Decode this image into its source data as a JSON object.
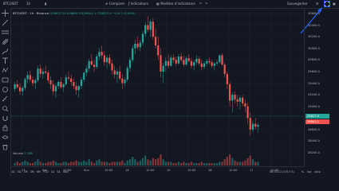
{
  "topbar": {
    "symbol": "BTCUSDT",
    "interval": "1h",
    "compare": "Comparer",
    "indicators": "Indicateurs",
    "templates": "Modèles d'indicateurs",
    "save": "Sauvegarder"
  },
  "legend": {
    "symbol": "BTCUSDT · 1h · Binance",
    "values": "O29837.9 H29860.9 B29841.1 C29837.9 −0.6 (−0.00%)"
  },
  "price_axis": [
    "30600.0",
    "30400.0",
    "30200.0",
    "30000.0",
    "29800.0",
    "29600.0",
    "29400.0",
    "29200.0",
    "29000.0",
    "28800.0",
    "28600.0",
    "28400.0",
    "28200.0"
  ],
  "price_tags": {
    "last": "29827.9",
    "prev": "29841.1"
  },
  "time_axis": [
    "13",
    "Sat",
    "12:00",
    "Sun",
    "12:00",
    "14",
    "12:00",
    "15",
    "12:00",
    "16",
    "12:00",
    "17",
    "12:00"
  ],
  "volume": {
    "label": "Volume",
    "value": "1.768"
  },
  "bottom_tabs": [
    "1D",
    "5D",
    "1M",
    "3M",
    "6M",
    "YTD",
    "1A",
    "5A",
    "Tout"
  ],
  "clock": "08:53:12 (UTC+2)",
  "bottom_right": [
    "%",
    "log",
    "auto"
  ],
  "colors": {
    "up": "#26a69a",
    "down": "#ef5350",
    "accent": "#2962ff"
  },
  "chart_data": {
    "type": "candlestick",
    "ylim": [
      28200,
      30600
    ],
    "ohlc": [
      [
        29300,
        29420,
        29250,
        29380
      ],
      [
        29380,
        29450,
        29300,
        29330
      ],
      [
        29330,
        29400,
        29200,
        29260
      ],
      [
        29260,
        29350,
        29180,
        29320
      ],
      [
        29320,
        29500,
        29280,
        29470
      ],
      [
        29470,
        29600,
        29400,
        29540
      ],
      [
        29540,
        29620,
        29420,
        29460
      ],
      [
        29460,
        29520,
        29350,
        29400
      ],
      [
        29400,
        29480,
        29300,
        29450
      ],
      [
        29450,
        29700,
        29420,
        29650
      ],
      [
        29650,
        29720,
        29500,
        29560
      ],
      [
        29560,
        29650,
        29480,
        29600
      ],
      [
        29600,
        29700,
        29550,
        29580
      ],
      [
        29580,
        29620,
        29400,
        29450
      ],
      [
        29450,
        29520,
        29300,
        29380
      ],
      [
        29380,
        29450,
        29200,
        29260
      ],
      [
        29260,
        29400,
        29150,
        29350
      ],
      [
        29350,
        29450,
        29300,
        29420
      ],
      [
        29420,
        29500,
        29300,
        29330
      ],
      [
        29330,
        29400,
        29250,
        29380
      ],
      [
        29380,
        29550,
        29350,
        29500
      ],
      [
        29500,
        29600,
        29450,
        29480
      ],
      [
        29480,
        29550,
        29350,
        29420
      ],
      [
        29420,
        29480,
        29300,
        29350
      ],
      [
        29350,
        29420,
        29200,
        29280
      ],
      [
        29280,
        29380,
        29150,
        29350
      ],
      [
        29350,
        29500,
        29300,
        29460
      ],
      [
        29460,
        29600,
        29420,
        29580
      ],
      [
        29580,
        29700,
        29520,
        29650
      ],
      [
        29650,
        29820,
        29600,
        29780
      ],
      [
        29780,
        29900,
        29700,
        29720
      ],
      [
        29720,
        29800,
        29600,
        29680
      ],
      [
        29680,
        29900,
        29650,
        29860
      ],
      [
        29860,
        30000,
        29800,
        29940
      ],
      [
        29940,
        30050,
        29820,
        29880
      ],
      [
        29880,
        29950,
        29700,
        29760
      ],
      [
        29760,
        29880,
        29650,
        29840
      ],
      [
        29840,
        29900,
        29700,
        29740
      ],
      [
        29740,
        29800,
        29550,
        29620
      ],
      [
        29620,
        29700,
        29480,
        29550
      ],
      [
        29550,
        29650,
        29400,
        29600
      ],
      [
        29600,
        29700,
        29450,
        29480
      ],
      [
        29480,
        29560,
        29300,
        29400
      ],
      [
        29400,
        29500,
        29350,
        29460
      ],
      [
        29460,
        29700,
        29420,
        29660
      ],
      [
        29660,
        29850,
        29600,
        29800
      ],
      [
        29800,
        30050,
        29760,
        30000
      ],
      [
        30000,
        30150,
        29900,
        30080
      ],
      [
        30080,
        30200,
        29980,
        30020
      ],
      [
        30020,
        30150,
        29950,
        30100
      ],
      [
        30100,
        30300,
        30050,
        30250
      ],
      [
        30250,
        30450,
        30200,
        30400
      ],
      [
        30400,
        30550,
        30280,
        30320
      ],
      [
        30320,
        30500,
        30200,
        30460
      ],
      [
        30460,
        30520,
        30150,
        30200
      ],
      [
        30200,
        30350,
        30000,
        30050
      ],
      [
        30050,
        30200,
        29800,
        29880
      ],
      [
        29880,
        30000,
        29500,
        29600
      ],
      [
        29600,
        29750,
        29400,
        29700
      ],
      [
        29700,
        29850,
        29600,
        29780
      ],
      [
        29780,
        29900,
        29650,
        29700
      ],
      [
        29700,
        29880,
        29680,
        29840
      ],
      [
        29840,
        29900,
        29750,
        29800
      ],
      [
        29800,
        29860,
        29700,
        29740
      ],
      [
        29740,
        29900,
        29720,
        29860
      ],
      [
        29860,
        29920,
        29760,
        29800
      ],
      [
        29800,
        29880,
        29680,
        29720
      ],
      [
        29720,
        29860,
        29700,
        29830
      ],
      [
        29830,
        29900,
        29760,
        29780
      ],
      [
        29780,
        29840,
        29650,
        29700
      ],
      [
        29700,
        29800,
        29620,
        29760
      ],
      [
        29760,
        29880,
        29720,
        29820
      ],
      [
        29820,
        29860,
        29700,
        29740
      ],
      [
        29740,
        29800,
        29620,
        29680
      ],
      [
        29680,
        29780,
        29640,
        29740
      ],
      [
        29740,
        29820,
        29700,
        29780
      ],
      [
        29780,
        29840,
        29720,
        29760
      ],
      [
        29760,
        29800,
        29660,
        29700
      ],
      [
        29700,
        29760,
        29620,
        29740
      ],
      [
        29740,
        29800,
        29700,
        29760
      ],
      [
        29760,
        29900,
        29740,
        29880
      ],
      [
        29880,
        29920,
        29700,
        29720
      ],
      [
        29720,
        29760,
        29500,
        29560
      ],
      [
        29560,
        29600,
        29300,
        29380
      ],
      [
        29380,
        29420,
        29000,
        29100
      ],
      [
        29100,
        29250,
        28900,
        29200
      ],
      [
        29200,
        29260,
        29050,
        29120
      ],
      [
        29120,
        29200,
        29000,
        29080
      ],
      [
        29080,
        29180,
        28950,
        29150
      ],
      [
        29150,
        29200,
        29000,
        29050
      ],
      [
        29050,
        29120,
        28900,
        29000
      ],
      [
        29000,
        29060,
        28700,
        28800
      ],
      [
        28800,
        28900,
        28500,
        28600
      ],
      [
        28600,
        28760,
        28550,
        28700
      ],
      [
        28700,
        28800,
        28600,
        28650
      ],
      [
        28650,
        28720,
        28550,
        28680
      ]
    ],
    "volume": [
      2,
      3,
      2,
      3,
      4,
      3,
      2,
      2,
      3,
      5,
      3,
      2,
      2,
      3,
      3,
      4,
      3,
      2,
      2,
      3,
      3,
      2,
      3,
      3,
      4,
      3,
      3,
      4,
      3,
      5,
      3,
      2,
      4,
      5,
      3,
      3,
      3,
      2,
      3,
      3,
      3,
      3,
      4,
      2,
      4,
      5,
      7,
      5,
      3,
      4,
      6,
      8,
      5,
      4,
      6,
      5,
      6,
      9,
      5,
      3,
      3,
      3,
      2,
      2,
      3,
      2,
      3,
      2,
      2,
      3,
      2,
      2,
      2,
      3,
      2,
      2,
      2,
      2,
      2,
      2,
      3,
      3,
      5,
      7,
      9,
      6,
      4,
      3,
      3,
      3,
      4,
      6,
      8,
      5,
      3,
      3
    ]
  }
}
